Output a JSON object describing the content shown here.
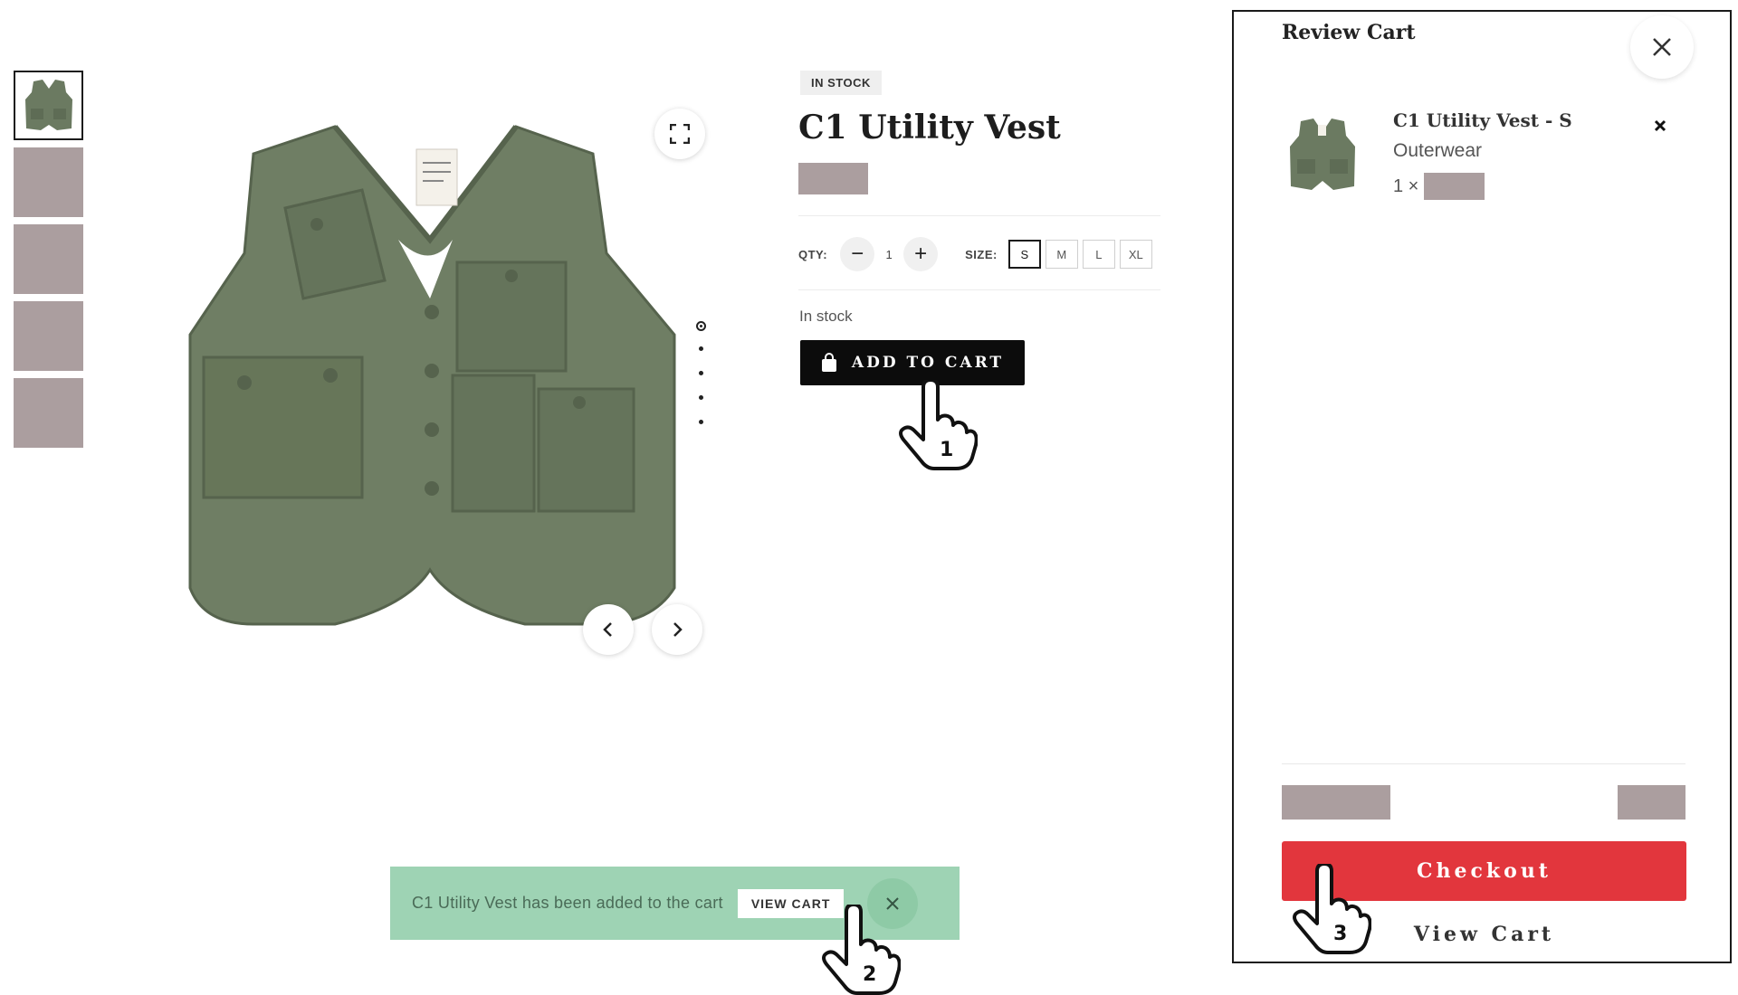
{
  "product": {
    "badge": "IN STOCK",
    "title": "C1 Utility Vest",
    "qty_label": "QTY:",
    "qty_value": "1",
    "qty_minus": "−",
    "qty_plus": "+",
    "size_label": "SIZE:",
    "sizes": [
      "S",
      "M",
      "L",
      "XL"
    ],
    "selected_size": "S",
    "stock_text": "In stock",
    "add_to_cart_label": "ADD TO CART"
  },
  "toast": {
    "message": "C1 Utility Vest has been added to the cart",
    "view_cart_label": "VIEW CART"
  },
  "cart": {
    "title": "Review Cart",
    "item": {
      "name": "C1 Utility Vest - S",
      "category": "Outerwear",
      "qty_text": "1 ×"
    },
    "checkout_label": "Checkout",
    "view_cart_label": "View Cart"
  },
  "annotations": {
    "step1": "1",
    "step2": "2",
    "step3": "3"
  },
  "colors": {
    "placeholder": "#ab9e9f",
    "vest_green": "#6b7a61",
    "toast_bg": "#9ed3b4",
    "checkout_red": "#e2363d"
  }
}
